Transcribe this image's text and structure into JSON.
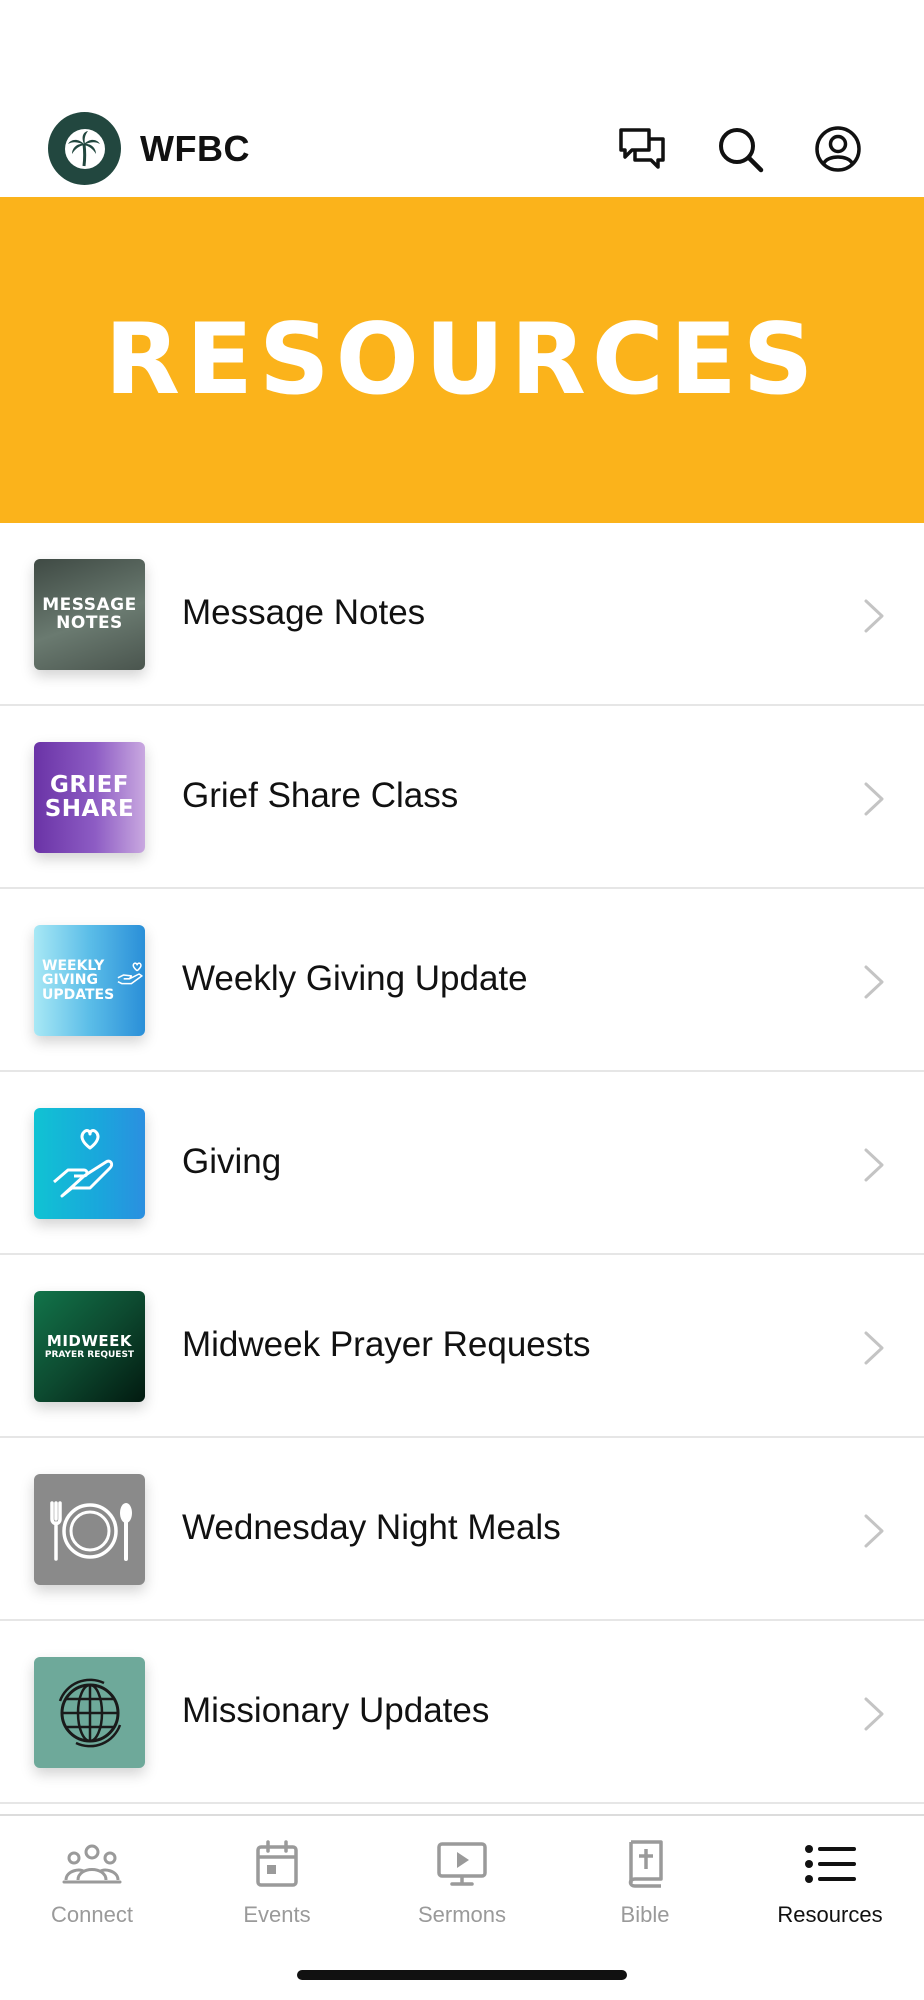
{
  "header": {
    "brand": "WFBC",
    "icons": [
      "chat-icon",
      "search-icon",
      "profile-icon"
    ]
  },
  "banner": {
    "title": "RESOURCES",
    "color": "#fbb31b"
  },
  "resources": [
    {
      "label": "Message Notes",
      "thumb_text": [
        "MESSAGE",
        "NOTES"
      ],
      "thumb_color": "#4d5b53"
    },
    {
      "label": "Grief Share Class",
      "thumb_text": [
        "GRIEF",
        "SHARE"
      ],
      "thumb_color": "#7a45b0"
    },
    {
      "label": "Weekly Giving Update",
      "thumb_text": [
        "WEEKLY",
        "GIVING",
        "UPDATES"
      ],
      "thumb_color": "#5bbde8"
    },
    {
      "label": "Giving",
      "thumb_icon": "hand-heart-icon",
      "thumb_color": "#16b6d8"
    },
    {
      "label": "Midweek Prayer Requests",
      "thumb_text": [
        "MIDWEEK",
        "PRAYER REQUEST"
      ],
      "thumb_color": "#0d5a38"
    },
    {
      "label": "Wednesday Night Meals",
      "thumb_icon": "plate-utensils-icon",
      "thumb_color": "#8a8a8a"
    },
    {
      "label": "Missionary Updates",
      "thumb_icon": "globe-icon",
      "thumb_color": "#6ea99a"
    }
  ],
  "tabs": [
    {
      "label": "Connect",
      "icon": "people-icon",
      "active": false
    },
    {
      "label": "Events",
      "icon": "calendar-icon",
      "active": false
    },
    {
      "label": "Sermons",
      "icon": "play-screen-icon",
      "active": false
    },
    {
      "label": "Bible",
      "icon": "bible-icon",
      "active": false
    },
    {
      "label": "Resources",
      "icon": "list-icon",
      "active": true
    }
  ]
}
